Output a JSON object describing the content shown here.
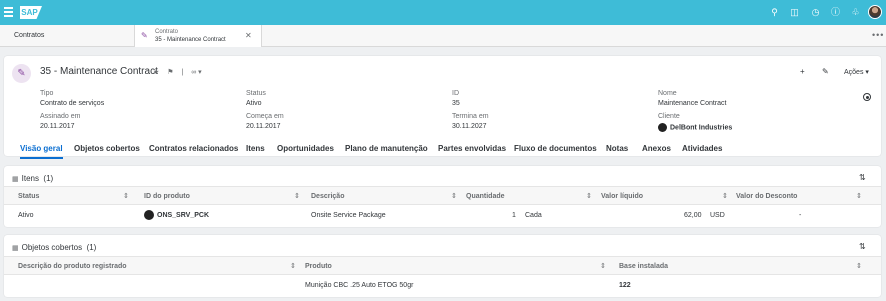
{
  "shell": {
    "logo": "SAP",
    "icons": [
      "search-icon",
      "feedback-icon",
      "history-icon",
      "help-icon",
      "notification-icon",
      "grid-icon"
    ]
  },
  "tabs": {
    "home": "Contratos",
    "active_line1": "Contrato",
    "active_line2": "35 - Maintenance Contract",
    "more": "•••"
  },
  "header": {
    "title": "35 - Maintenance Contract",
    "actions_label": "Ações",
    "fields": {
      "tipo_label": "Tipo",
      "tipo_value": "Contrato de serviços",
      "status_label": "Status",
      "status_value": "Ativo",
      "id_label": "ID",
      "id_value": "35",
      "nome_label": "Nome",
      "nome_value": "Maintenance Contract",
      "assinado_label": "Assinado em",
      "assinado_value": "20.11.2017",
      "comeca_label": "Começa em",
      "comeca_value": "20.11.2017",
      "termina_label": "Termina em",
      "termina_value": "30.11.2027",
      "cliente_label": "Cliente",
      "cliente_value": "DelBont Industries"
    },
    "nav": [
      "Visão geral",
      "Objetos cobertos",
      "Contratos relacionados",
      "Itens",
      "Oportunidades",
      "Plano de manutenção",
      "Partes envolvidas",
      "Fluxo de documentos",
      "Notas",
      "Anexos",
      "Atividades"
    ]
  },
  "itens": {
    "title": "Itens",
    "count": "(1)",
    "columns": [
      "Status",
      "ID do produto",
      "Descrição",
      "Quantidade",
      "Valor líquido",
      "Valor do Desconto"
    ],
    "row": {
      "status": "Ativo",
      "product_id": "ONS_SRV_PCK",
      "descricao": "Onsite Service Package",
      "quantidade": "1",
      "unidade": "Cada",
      "valor": "62,00",
      "moeda": "USD",
      "desconto": "-"
    }
  },
  "objetos": {
    "title": "Objetos cobertos",
    "count": "(1)",
    "columns": [
      "Descrição do produto registrado",
      "Produto",
      "Base instalada"
    ],
    "row": {
      "descricao": "",
      "produto": "Munição CBC .25 Auto ETOG 50gr",
      "base": "122"
    }
  }
}
